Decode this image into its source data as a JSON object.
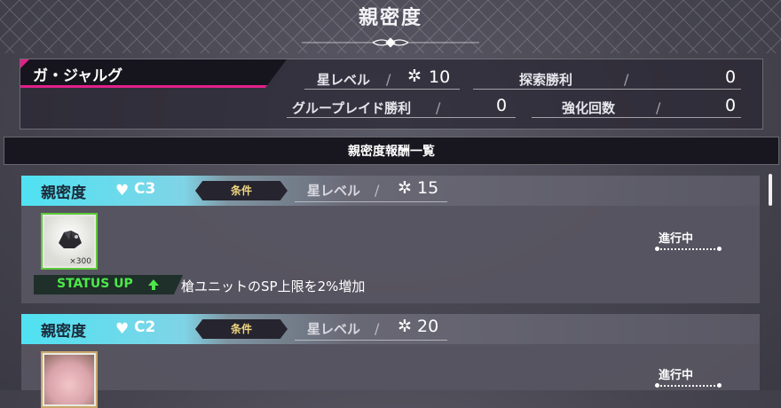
{
  "header": {
    "title": "親密度"
  },
  "profile": {
    "name": "ガ・ジャルグ",
    "stats": [
      {
        "label": "星レベル",
        "value": "10",
        "icon": "star-icon"
      },
      {
        "label": "探索勝利",
        "value": "0"
      },
      {
        "label": "グループレイド勝利",
        "value": "0"
      },
      {
        "label": "強化回数",
        "value": "0"
      }
    ]
  },
  "section": {
    "title": "親密度報酬一覧"
  },
  "rewards": [
    {
      "title": "親密度",
      "rank": "C3",
      "condition_badge": "条件",
      "condition_label": "星レベル",
      "condition_value": "15",
      "item_qty": "×300",
      "progress": "進行中",
      "status_label": "STATUS UP",
      "effect": "槍ユニットのSP上限を2%増加"
    },
    {
      "title": "親密度",
      "rank": "C2",
      "condition_badge": "条件",
      "condition_label": "星レベル",
      "condition_value": "20",
      "progress": "進行中"
    }
  ],
  "colors": {
    "accent_pink": "#e0208a",
    "accent_cyan": "#4fe2f2",
    "status_green": "#4ee84b"
  }
}
